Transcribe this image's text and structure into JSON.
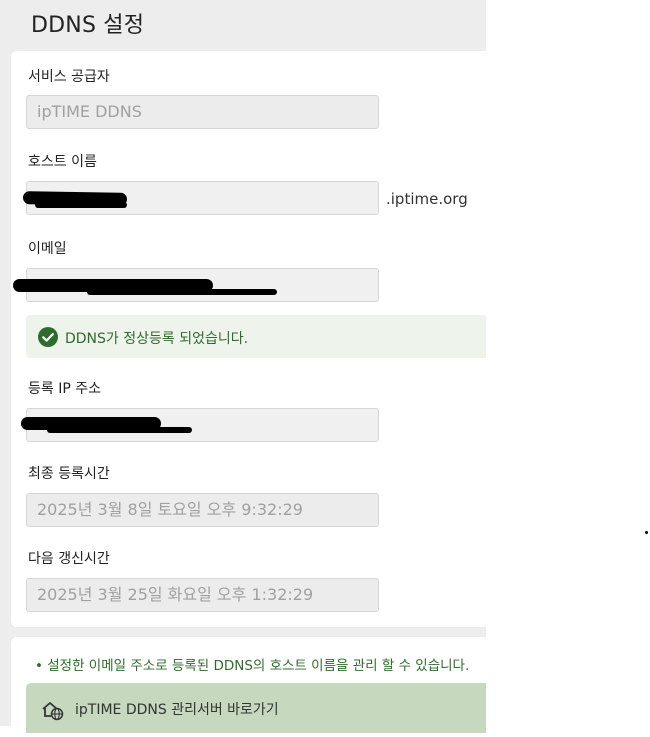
{
  "page": {
    "title": "DDNS 설정"
  },
  "form": {
    "provider": {
      "label": "서비스 공급자",
      "value": "ipTIME DDNS"
    },
    "hostname": {
      "label": "호스트 이름",
      "suffix": ".iptime.org"
    },
    "email": {
      "label": "이메일"
    },
    "status": {
      "icon": "check-circle-icon",
      "text": "DDNS가 정상등록 되었습니다.",
      "color": "#2f6b2c"
    },
    "registered_ip": {
      "label": "등록 IP 주소"
    },
    "last_registered": {
      "label": "최종 등록시간",
      "value": "2025년 3월 8일 토요일 오후 9:32:29"
    },
    "next_renewal": {
      "label": "다음 갱신시간",
      "value": "2025년 3월 25일 화요일 오후 1:32:29"
    }
  },
  "info": {
    "note": "• 설정한 이메일 주소로 등록된 DDNS의 호스트 이름을 관리 할 수 있습니다.",
    "link_label": "ipTIME DDNS 관리서버 바로가기",
    "link_icon": "home-globe-icon"
  }
}
